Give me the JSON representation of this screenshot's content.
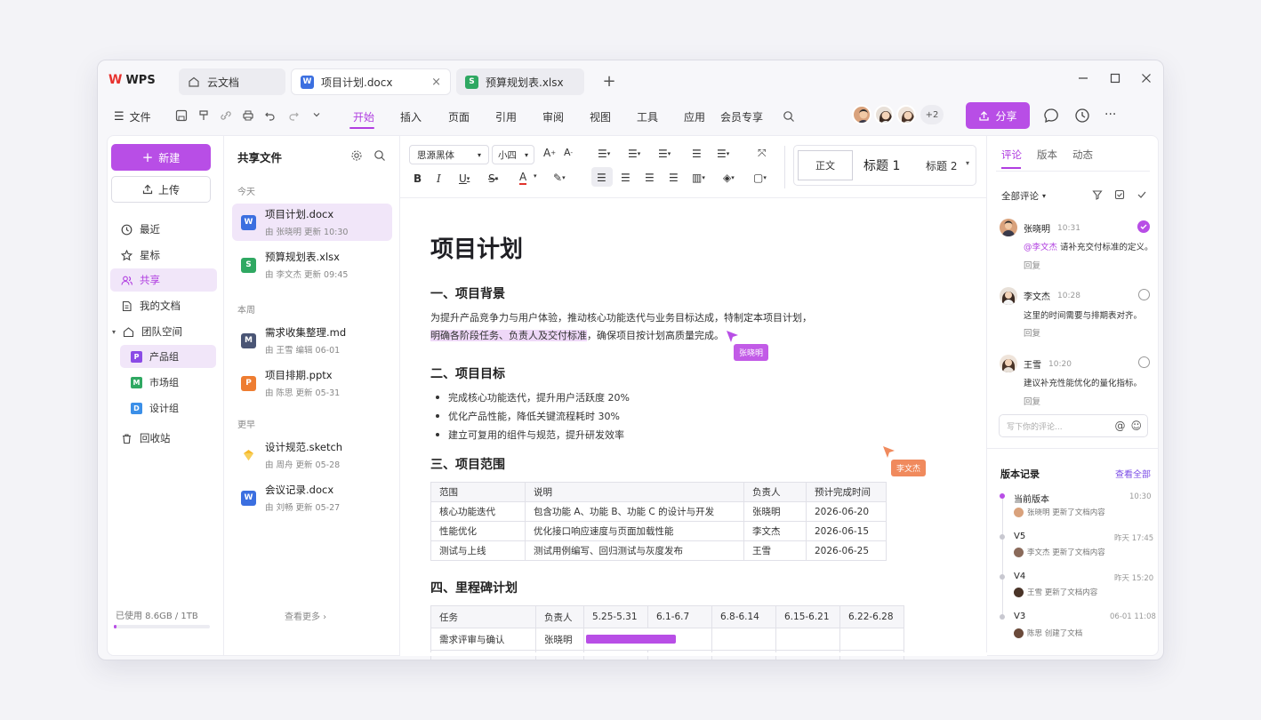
{
  "app": {
    "logo": "WPS"
  },
  "tabs": [
    {
      "label": "云文档",
      "icon": "home-icon"
    },
    {
      "label": "项目计划.docx",
      "icon": "word-doc-icon",
      "badge": "W"
    },
    {
      "label": "预算规划表.xlsx",
      "icon": "sheet-icon",
      "badge": "S"
    }
  ],
  "menu": {
    "file": "文件",
    "items": [
      "开始",
      "插入",
      "页面",
      "引用",
      "审阅",
      "视图",
      "工具",
      "应用",
      "会员专享"
    ],
    "active": "开始"
  },
  "collab": {
    "more_count": "+2",
    "share_label": "分享"
  },
  "sidebar": {
    "new_label": "新建",
    "upload_label": "上传",
    "items": [
      {
        "label": "最近",
        "icon": "clock-icon"
      },
      {
        "label": "星标",
        "icon": "star-icon"
      },
      {
        "label": "共享",
        "icon": "users-icon"
      },
      {
        "label": "我的文档",
        "icon": "document-icon"
      },
      {
        "label": "团队空间",
        "icon": "home-icon"
      }
    ],
    "groups": [
      {
        "label": "产品组",
        "badge": "P",
        "color": "#8a4be6"
      },
      {
        "label": "市场组",
        "badge": "M",
        "color": "#2fa862"
      },
      {
        "label": "设计组",
        "badge": "D",
        "color": "#3b8fe8"
      }
    ],
    "trash": "回收站",
    "storage": "已使用 8.6GB / 1TB",
    "storage_fraction": 0.03
  },
  "files": {
    "title": "共享文件",
    "sections": [
      "今天",
      "本周",
      "更早"
    ],
    "items": [
      {
        "name": "项目计划.docx",
        "meta": "由 张晓明 更新 10:30",
        "type": "W"
      },
      {
        "name": "预算规划表.xlsx",
        "meta": "由 李文杰 更新 09:45",
        "type": "S"
      },
      {
        "name": "需求收集整理.md",
        "meta": "由 王雪 编辑 06-01",
        "type": "M"
      },
      {
        "name": "项目排期.pptx",
        "meta": "由 陈思 更新 05-31",
        "type": "P"
      },
      {
        "name": "设计规范.sketch",
        "meta": "由 周舟 更新 05-28",
        "type": "sketch"
      },
      {
        "name": "会议记录.docx",
        "meta": "由 刘畅 更新 05-27",
        "type": "W"
      }
    ],
    "more": "查看更多"
  },
  "toolbar": {
    "font": "思源黑体",
    "size": "小四",
    "styles": {
      "normal": "正文",
      "h1": "标题 1",
      "h2": "标题 2"
    }
  },
  "doc": {
    "title": "项目计划",
    "s1": "一、项目背景",
    "p1a": "为提升产品竞争力与用户体验，推动核心功能迭代与业务目标达成，特制定本项目计划，",
    "p1b_hl": "明确各阶段任务、负责人及交付标准",
    "p1b_rest": "，确保项目按计划高质量完成。",
    "s2": "二、项目目标",
    "goals": [
      "完成核心功能迭代，提升用户活跃度 20%",
      "优化产品性能，降低关键流程耗时 30%",
      "建立可复用的组件与规范，提升研发效率"
    ],
    "s3": "三、项目范围",
    "scope_head": [
      "范围",
      "说明",
      "负责人",
      "预计完成时间"
    ],
    "scope_rows": [
      [
        "核心功能迭代",
        "包含功能 A、功能 B、功能 C 的设计与开发",
        "张晓明",
        "2026-06-20"
      ],
      [
        "性能优化",
        "优化接口响应速度与页面加载性能",
        "李文杰",
        "2026-06-15"
      ],
      [
        "测试与上线",
        "测试用例编写、回归测试与灰度发布",
        "王雪",
        "2026-06-25"
      ]
    ],
    "s4": "四、里程碑计划",
    "ms_head": [
      "任务",
      "负责人",
      "5.25-5.31",
      "6.1-6.7",
      "6.8-6.14",
      "6.15-6.21",
      "6.22-6.28"
    ],
    "ms_row": {
      "task": "需求评审与确认",
      "owner": "张晓明"
    },
    "cursor1": "张晓明",
    "cursor2": "李文杰"
  },
  "comments": {
    "tabs": [
      "评论",
      "版本",
      "动态"
    ],
    "filter": "全部评论",
    "list": [
      {
        "name": "张晓明",
        "time": "10:31",
        "mention": "@李文杰",
        "text": " 请补充交付标准的定义。",
        "reply": "回复",
        "resolved": true
      },
      {
        "name": "李文杰",
        "time": "10:28",
        "text": "这里的时间需要与排期表对齐。",
        "reply": "回复"
      },
      {
        "name": "王雪",
        "time": "10:20",
        "text": "建议补充性能优化的量化指标。",
        "reply": "回复"
      }
    ],
    "input_placeholder": "写下你的评论..."
  },
  "versions": {
    "title": "版本记录",
    "view_all": "查看全部",
    "list": [
      {
        "name": "当前版本",
        "time": "10:30",
        "desc": "张晓明 更新了文档内容"
      },
      {
        "name": "V5",
        "time": "昨天 17:45",
        "desc": "李文杰 更新了文档内容"
      },
      {
        "name": "V4",
        "time": "昨天 15:20",
        "desc": "王雪 更新了文档内容"
      },
      {
        "name": "V3",
        "time": "06-01 11:08",
        "desc": "陈思 创建了文档"
      }
    ]
  }
}
